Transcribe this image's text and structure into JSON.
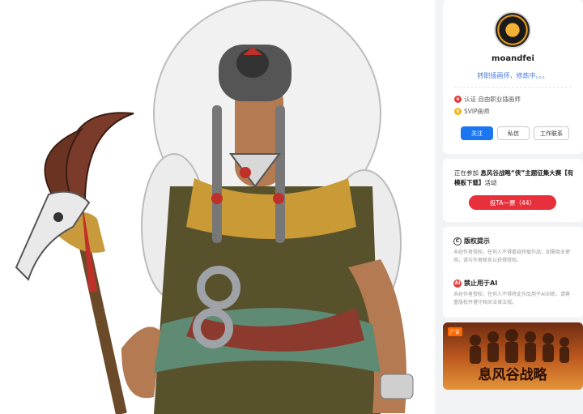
{
  "artwork": {
    "alt": ""
  },
  "profile": {
    "username": "moandfei",
    "bio": "转职插画师，修炼中。。。",
    "badges": [
      {
        "icon": "verified-icon",
        "text": "认证 自由职业插画师"
      },
      {
        "icon": "svip-icon",
        "text": "SVIP画师"
      }
    ],
    "buttons": {
      "follow": "关注",
      "message": "私信",
      "work_contact": "工作联系"
    }
  },
  "event": {
    "prefix": "正在参加",
    "link": "息风谷战略“侠”主题征集大赛【有模板下载】",
    "suffix": "活动",
    "vote_button": "投TA一票（44）"
  },
  "notices": {
    "copyright": {
      "title": "版权提示",
      "body": "未经作者授权，任何人不得擅自转载作品；如需商业使用，请与作者联系以获得授权。"
    },
    "no_ai": {
      "title": "禁止用于AI",
      "body": "未经作者授权，任何人不得将此作品用于AI训练，请尊重版权并遵守相关法律法规。"
    }
  },
  "ad": {
    "tag": "广告",
    "title": "息风谷战略"
  },
  "colors": {
    "accent": "#1b76f0",
    "vote": "#e8303c",
    "link": "#4a7bd6"
  }
}
